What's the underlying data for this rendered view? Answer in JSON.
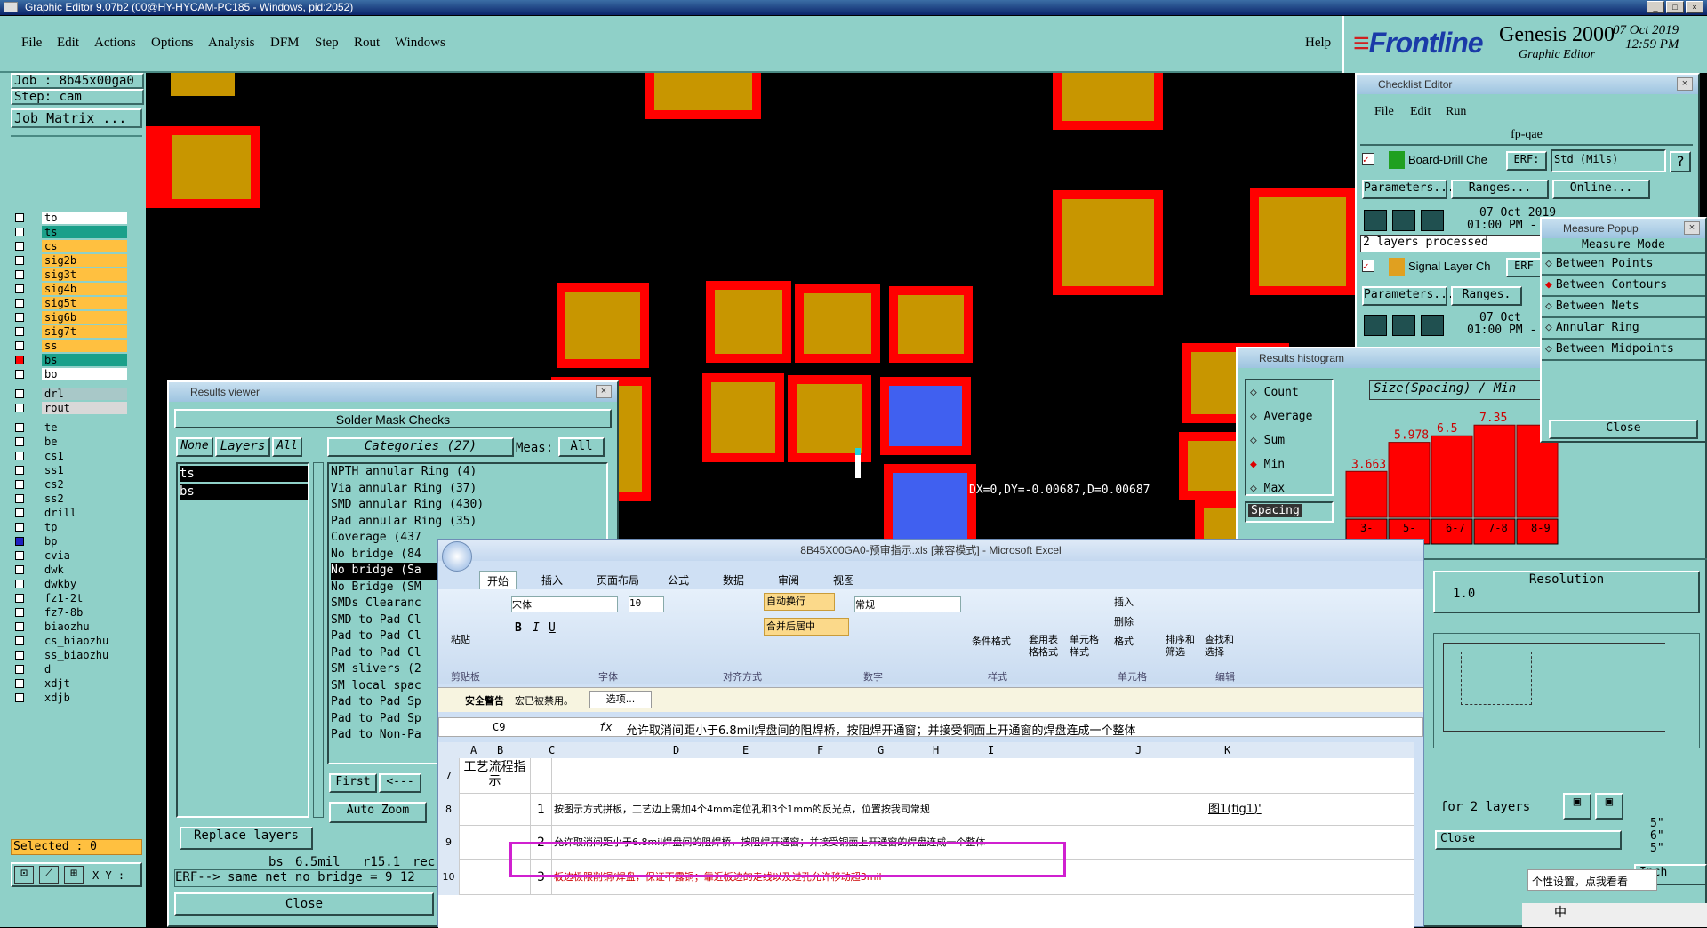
{
  "title_bar": {
    "title": "Graphic Editor 9.07b2 (00@HY-HYCAM-PC185 - Windows, pid:2052)"
  },
  "menu": {
    "items": [
      "File",
      "Edit",
      "Actions",
      "Options",
      "Analysis",
      "DFM",
      "Step",
      "Rout",
      "Windows"
    ],
    "help": "Help"
  },
  "logo": {
    "brand": "Frontline",
    "product": "Genesis 2000",
    "subtitle": "Graphic Editor",
    "date": "07 Oct 2019",
    "time": "12:59 PM"
  },
  "left_panel": {
    "job": "Job : 8b45x00ga0",
    "step": "Step: cam",
    "job_matrix": "Job Matrix ...",
    "layers": [
      {
        "name": "to",
        "color": "#ffffff"
      },
      {
        "name": "ts",
        "color": "#1aa08a"
      },
      {
        "name": "cs",
        "color": "#ffc040"
      },
      {
        "name": "sig2b",
        "color": "#ffc040"
      },
      {
        "name": "sig3t",
        "color": "#ffc040"
      },
      {
        "name": "sig4b",
        "color": "#ffc040"
      },
      {
        "name": "sig5t",
        "color": "#ffc040"
      },
      {
        "name": "sig6b",
        "color": "#ffc040"
      },
      {
        "name": "sig7t",
        "color": "#ffc040"
      },
      {
        "name": "ss",
        "color": "#ffc040"
      },
      {
        "name": "bs",
        "color": "#1aa08a",
        "swatch": "#ff0000"
      },
      {
        "name": "bo",
        "color": "#ffffff"
      },
      {
        "name": "drl",
        "color": "#a8c8c8",
        "gap": true
      },
      {
        "name": "rout",
        "color": "#d8d8d8"
      },
      {
        "name": "te",
        "color": "#8fd0c8",
        "gap": true
      },
      {
        "name": "be",
        "color": "#8fd0c8"
      },
      {
        "name": "cs1",
        "color": "#8fd0c8"
      },
      {
        "name": "ss1",
        "color": "#8fd0c8"
      },
      {
        "name": "cs2",
        "color": "#8fd0c8"
      },
      {
        "name": "ss2",
        "color": "#8fd0c8"
      },
      {
        "name": "drill",
        "color": "#8fd0c8"
      },
      {
        "name": "tp",
        "color": "#8fd0c8"
      },
      {
        "name": "bp",
        "color": "#8fd0c8",
        "swatch": "#2020c0"
      },
      {
        "name": "cvia",
        "color": "#8fd0c8"
      },
      {
        "name": "dwk",
        "color": "#8fd0c8"
      },
      {
        "name": "dwkby",
        "color": "#8fd0c8"
      },
      {
        "name": "fz1-2t",
        "color": "#8fd0c8"
      },
      {
        "name": "fz7-8b",
        "color": "#8fd0c8"
      },
      {
        "name": "biaozhu",
        "color": "#8fd0c8"
      },
      {
        "name": "cs_biaozhu",
        "color": "#8fd0c8"
      },
      {
        "name": "ss_biaozhu",
        "color": "#8fd0c8"
      },
      {
        "name": "d",
        "color": "#8fd0c8"
      },
      {
        "name": "xdjt",
        "color": "#8fd0c8"
      },
      {
        "name": "xdjb",
        "color": "#8fd0c8"
      }
    ],
    "selected": "Selected : 0",
    "xy_label": "X Y :"
  },
  "canvas": {
    "measure_readout": "DX=0,DY=-0.00687,D=0.00687"
  },
  "results_viewer": {
    "title": "Results viewer",
    "header": "Solder Mask Checks",
    "none": "None",
    "layers": "Layers",
    "all": "All",
    "categories": "Categories (27)",
    "meas": "Meas:",
    "meas_val": "All",
    "selected_layers": [
      "ts",
      "bs"
    ],
    "categories_list": [
      "NPTH annular Ring (4)",
      "Via annular Ring (37)",
      "SMD annular Ring (430)",
      "Pad annular Ring (35)",
      "Coverage (437",
      "No bridge (84",
      "No bridge (Sa",
      "No Bridge (SM",
      "SMDs Clearanc",
      "SMD to Pad Cl",
      "Pad to Pad Cl",
      "Pad to Pad Cl",
      "SM slivers (2",
      "SM local spac",
      "Pad to Pad Sp",
      "Pad to Pad Sp",
      "Pad to Non-Pa"
    ],
    "first": "First",
    "prev": "<---",
    "auto_zoom": "Auto Zoom",
    "replace_layers": "Replace layers",
    "stat1": "bs",
    "stat2": "6.5mil",
    "stat3": "r15.1",
    "stat4": "rec",
    "erf": "ERF--> same_net_no_bridge = 9 12",
    "close": "Close"
  },
  "checklist": {
    "title": "Checklist Editor",
    "menu": [
      "File",
      "Edit",
      "Run"
    ],
    "name": "fp-qae",
    "row1": "Board-Drill Che",
    "erf": "ERF:",
    "std": "Std (Mils)",
    "params": "Parameters...",
    "ranges": "Ranges...",
    "online": "Online...",
    "date": "07 Oct 2019",
    "time": "01:00 PM -",
    "processed": "2 layers processed",
    "row2": "Signal Layer Ch",
    "erf2": "ERF",
    "date2": "07 Oct",
    "time2": "01:00 PM -",
    "ranges2": "Ranges."
  },
  "measure": {
    "title": "Measure Popup",
    "mode": "Measure Mode",
    "options": [
      "Between Points",
      "Between Contours",
      "Between Nets",
      "Annular Ring",
      "Between Midpoints"
    ],
    "close": "Close"
  },
  "histogram": {
    "title": "Results histogram",
    "options": [
      "Count",
      "Average",
      "Sum",
      "Min",
      "Max"
    ],
    "selected": "Min",
    "spacing": "Spacing",
    "heading": "Size(Spacing) / Min",
    "resolution": "Resolution",
    "res_val": "1.0",
    "for_layers": "for 2 layers",
    "close": "Close",
    "inch": "Inch",
    "side_vals": [
      "5\"",
      "6\"",
      "5\""
    ]
  },
  "chart_data": {
    "type": "bar",
    "title": "Size(Spacing) / Min",
    "categories": [
      "3-",
      "5-",
      "6-7",
      "7-8",
      "8-9"
    ],
    "values": [
      3.663,
      5.978,
      6.5,
      7.35,
      7.35
    ],
    "labels": [
      "3.663",
      "5.978",
      "6.5",
      "7.35",
      ""
    ],
    "ylim": [
      0,
      8.5
    ]
  },
  "excel": {
    "title": "8B45X00GA0-预审指示.xls [兼容模式] - Microsoft Excel",
    "tabs": [
      "开始",
      "插入",
      "页面布局",
      "公式",
      "数据",
      "审阅",
      "视图"
    ],
    "font": "宋体",
    "size": "10",
    "number_format": "常规",
    "groups": [
      "剪贴板",
      "字体",
      "对齐方式",
      "数字",
      "样式",
      "单元格",
      "编辑"
    ],
    "paste": "粘贴",
    "wrap": "自动换行",
    "merge": "合并后居中",
    "cond": "条件格式",
    "table": "套用表格格式",
    "cellstyle": "单元格样式",
    "insert": "插入",
    "delete": "删除",
    "format": "格式",
    "sort": "排序和筛选",
    "find": "查找和选择",
    "security": "安全警告",
    "macro": "宏已被禁用。",
    "options": "选项...",
    "cell_ref": "C9",
    "fx": "fx",
    "formula": "允许取消间距小于6.8mil焊盘间的阻焊桥，按阻焊开通窗；并接受铜面上开通窗的焊盘连成一个整体",
    "cols": [
      "A",
      "B",
      "C",
      "D",
      "E",
      "F",
      "G",
      "H",
      "I",
      "J",
      "K"
    ],
    "rows": [
      {
        "num": "7",
        "a": "工艺流程指示",
        "b": "",
        "c": "",
        "j": ""
      },
      {
        "num": "8",
        "a": "",
        "b": "1",
        "c": "按图示方式拼板，工艺边上需加4个4mm定位孔和3个1mm的反光点，位置按我司常规",
        "j": "图1(fig1)'"
      },
      {
        "num": "9",
        "a": "",
        "b": "2",
        "c": "允许取消间距小于6.8mil焊盘间的阻焊桥，按阻焊开通窗；并接受铜面上开通窗的焊盘连成一个整体",
        "j": ""
      },
      {
        "num": "10",
        "a": "",
        "b": "3",
        "c": "板边极限削铜/焊盘，保证不露铜；靠近板边的走线以及过孔允许移动超3mil",
        "j": ""
      }
    ]
  },
  "ime": {
    "tip": "个性设置，点我看看",
    "lang": "中"
  }
}
